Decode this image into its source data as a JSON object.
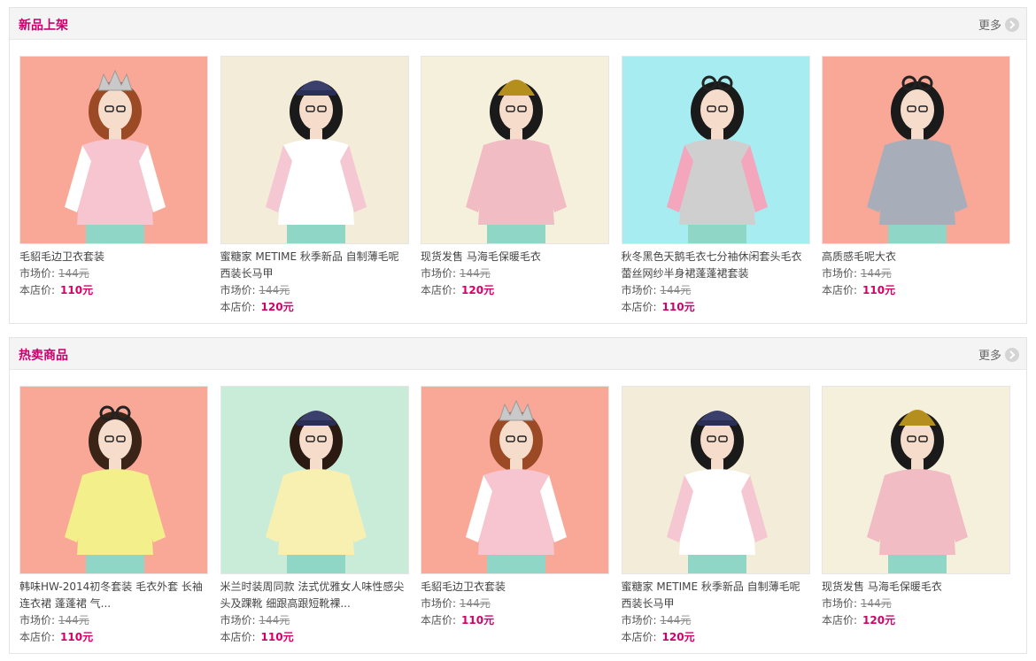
{
  "sections": [
    {
      "title": "新品上架",
      "more": "更多",
      "products": [
        {
          "name": "毛貂毛边卫衣套装",
          "market_label": "市场价:",
          "market_price": "144元",
          "store_label": "本店价:",
          "store_price": "110元",
          "bg": "#f9a898",
          "top": "#f6c5cf",
          "sleeve": "#ffffff",
          "hair": "#9b4a25",
          "hat": "crown"
        },
        {
          "name": "蜜糖家 METIME 秋季新品 自制薄毛呢西装长马甲",
          "market_label": "市场价:",
          "market_price": "144元",
          "store_label": "本店价:",
          "store_price": "120元",
          "bg": "#f3ecd8",
          "top": "#ffffff",
          "sleeve": "#f4c7d3",
          "hair": "#1a1a1a",
          "hat": "cap"
        },
        {
          "name": "现货发售 马海毛保暖毛衣",
          "market_label": "市场价:",
          "market_price": "144元",
          "store_label": "本店价:",
          "store_price": "120元",
          "bg": "#f5f0dc",
          "top": "#f1bcc3",
          "sleeve": "#f1bcc3",
          "hair": "#1a1a1a",
          "hat": "beanie"
        },
        {
          "name": "秋冬黑色天鹅毛衣七分袖休闲套头毛衣蕾丝网纱半身裙蓬蓬裙套装",
          "market_label": "市场价:",
          "market_price": "144元",
          "store_label": "本店价:",
          "store_price": "110元",
          "bg": "#a6ecf0",
          "top": "#cfcfcf",
          "sleeve": "#f4a6bd",
          "hair": "#1a1a1a",
          "hat": "sunglasses"
        },
        {
          "name": "高质感毛呢大衣",
          "market_label": "市场价:",
          "market_price": "144元",
          "store_label": "本店价:",
          "store_price": "110元",
          "bg": "#f9a898",
          "top": "#a8aeb9",
          "sleeve": "#a8aeb9",
          "hair": "#1a1a1a",
          "hat": "sunglasses"
        }
      ]
    },
    {
      "title": "热卖商品",
      "more": "更多",
      "products": [
        {
          "name": "韩味HW-2014初冬套装 毛衣外套 长袖连衣裙 蓬蓬裙 气...",
          "market_label": "市场价:",
          "market_price": "144元",
          "store_label": "本店价:",
          "store_price": "110元",
          "bg": "#f9a898",
          "top": "#f3ef8a",
          "sleeve": "#f3ef8a",
          "hair": "#3a2418",
          "hat": "sunglasses"
        },
        {
          "name": "米兰时装周同款 法式优雅女人味性感尖头及踝靴 细跟高跟短靴裸...",
          "market_label": "市场价:",
          "market_price": "144元",
          "store_label": "本店价:",
          "store_price": "110元",
          "bg": "#c9ecd9",
          "top": "#f8f0b0",
          "sleeve": "#f8f0b0",
          "hair": "#2a1a12",
          "hat": "cap"
        },
        {
          "name": "毛貂毛边卫衣套装",
          "market_label": "市场价:",
          "market_price": "144元",
          "store_label": "本店价:",
          "store_price": "110元",
          "bg": "#f9a898",
          "top": "#f6c5cf",
          "sleeve": "#ffffff",
          "hair": "#9b4a25",
          "hat": "crown"
        },
        {
          "name": "蜜糖家 METIME 秋季新品 自制薄毛呢西装长马甲",
          "market_label": "市场价:",
          "market_price": "144元",
          "store_label": "本店价:",
          "store_price": "120元",
          "bg": "#f3ecd8",
          "top": "#ffffff",
          "sleeve": "#f4c7d3",
          "hair": "#1a1a1a",
          "hat": "cap"
        },
        {
          "name": "现货发售 马海毛保暖毛衣",
          "market_label": "市场价:",
          "market_price": "144元",
          "store_label": "本店价:",
          "store_price": "120元",
          "bg": "#f5f0dc",
          "top": "#f1bcc3",
          "sleeve": "#f1bcc3",
          "hair": "#1a1a1a",
          "hat": "beanie"
        }
      ]
    }
  ]
}
